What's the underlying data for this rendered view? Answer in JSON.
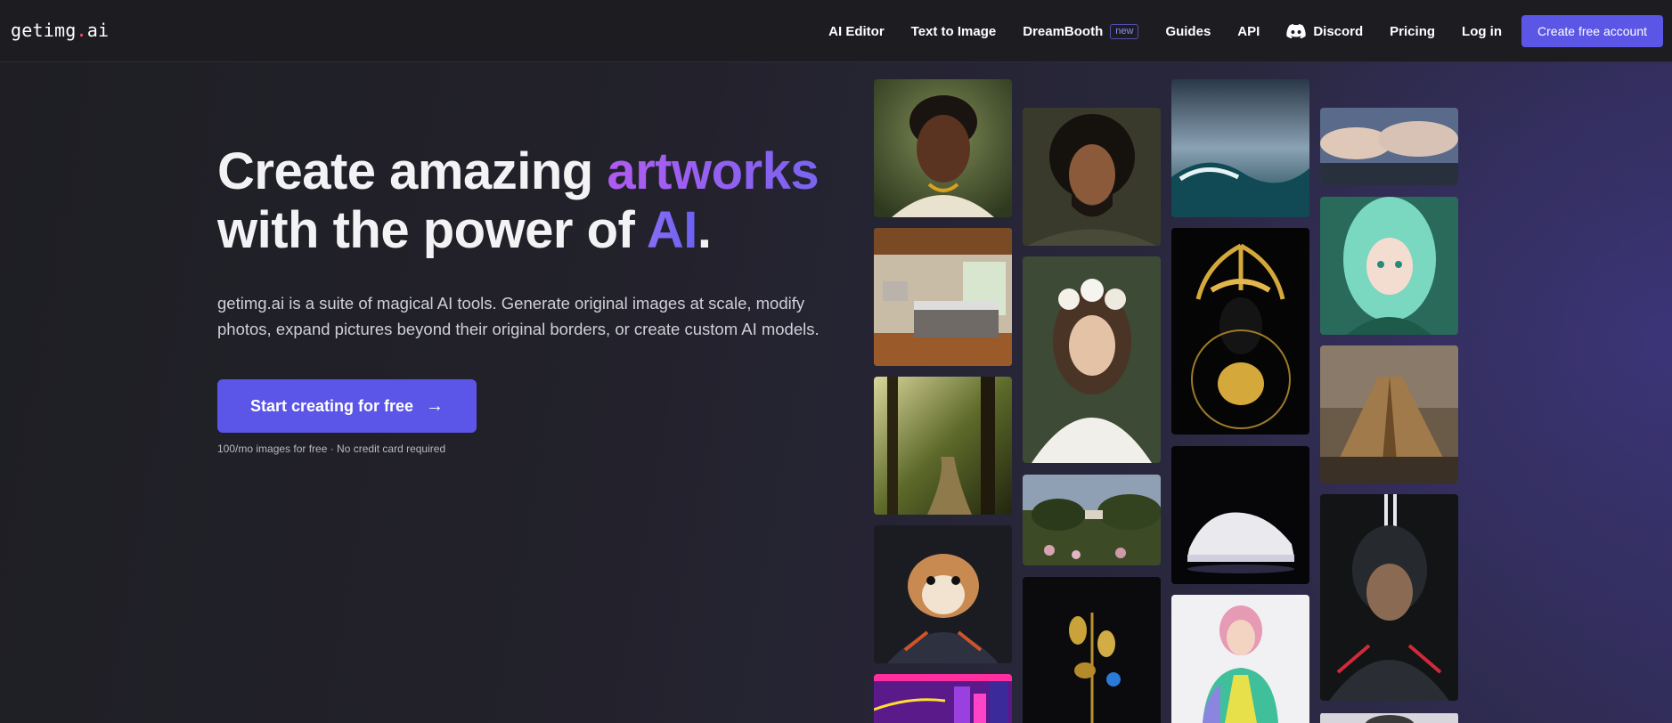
{
  "logo": {
    "text_before": "getimg",
    "dot": ".",
    "text_after": "ai"
  },
  "nav": {
    "items": [
      {
        "label": "AI Editor"
      },
      {
        "label": "Text to Image"
      },
      {
        "label": "DreamBooth",
        "badge": "new"
      },
      {
        "label": "Guides"
      },
      {
        "label": "API"
      },
      {
        "label": "Discord",
        "icon": "discord-icon"
      },
      {
        "label": "Pricing"
      },
      {
        "label": "Log in"
      }
    ],
    "cta": "Create free account"
  },
  "hero": {
    "title_part1": "Create amazing ",
    "title_highlight1": "artworks",
    "title_part2": "with the power of ",
    "title_highlight2": "AI",
    "title_end": ".",
    "description": "getimg.ai is a suite of magical AI tools. Generate original images at scale, modify photos, expand pictures beyond their original borders, or create custom AI models.",
    "button_label": "Start creating for free",
    "button_icon": "arrow-right-icon",
    "note": "100/mo images for free · No credit card required"
  },
  "colors": {
    "accent": "#5b55e8",
    "gradient_start": "#b05cf0",
    "gradient_end": "#6a62f0",
    "logo_dot": "#ff4f6d"
  },
  "gallery": {
    "images": [
      {
        "name": "portrait-smiling-man-image"
      },
      {
        "name": "bedroom-interior-image"
      },
      {
        "name": "sunlit-forest-image"
      },
      {
        "name": "astronaut-hamster-image"
      },
      {
        "name": "neon-city-image"
      },
      {
        "name": "bearded-warrior-image"
      },
      {
        "name": "flower-crown-woman-image"
      },
      {
        "name": "garden-landscape-image"
      },
      {
        "name": "golden-flowers-image"
      },
      {
        "name": "ocean-storm-image"
      },
      {
        "name": "golden-mask-figure-image"
      },
      {
        "name": "white-sneaker-image"
      },
      {
        "name": "pink-hair-girl-image"
      },
      {
        "name": "sky-clouds-image"
      },
      {
        "name": "anime-girl-image"
      },
      {
        "name": "pyramid-image"
      },
      {
        "name": "cyber-warrior-image"
      },
      {
        "name": "partial-portrait-image"
      }
    ]
  }
}
